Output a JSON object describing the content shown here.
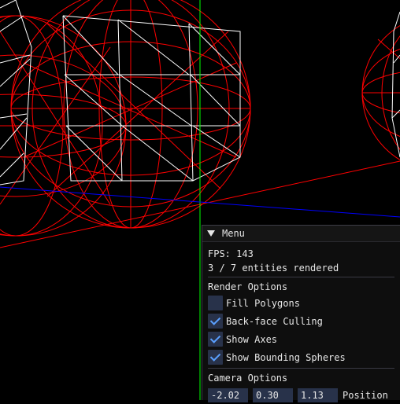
{
  "menu": {
    "title": "Menu",
    "fps": "FPS: 143",
    "entities": "3 / 7 entities rendered",
    "render_options": {
      "header": "Render Options",
      "items": [
        {
          "label": "Fill Polygons",
          "checked": false
        },
        {
          "label": "Back-face Culling",
          "checked": true
        },
        {
          "label": "Show Axes",
          "checked": true
        },
        {
          "label": "Show Bounding Spheres",
          "checked": true
        }
      ]
    },
    "camera_options": {
      "header": "Camera Options",
      "position": [
        "-2.02",
        "0.30",
        "1.13"
      ],
      "position_label": "Position"
    }
  },
  "colors": {
    "wireframe": "#ffffff",
    "bounding_sphere": "#ff0000",
    "axis_y": "#00ff00",
    "axis_z": "#0000ff",
    "checkbox_bg": "#28324a",
    "checkmark": "#5aa0ff"
  }
}
